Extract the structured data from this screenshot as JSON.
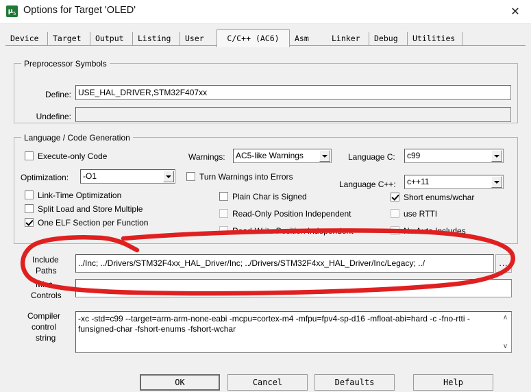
{
  "window": {
    "title": "Options for Target 'OLED'",
    "icon": "keil-uvision5-icon",
    "close_label": "✕"
  },
  "tabs": [
    {
      "label": "Device",
      "selected": false
    },
    {
      "label": "Target",
      "selected": false
    },
    {
      "label": "Output",
      "selected": false
    },
    {
      "label": "Listing",
      "selected": false
    },
    {
      "label": "User",
      "selected": false
    },
    {
      "label": "C/C++ (AC6)",
      "selected": true
    },
    {
      "label": "Asm",
      "selected": false
    },
    {
      "label": "Linker",
      "selected": false
    },
    {
      "label": "Debug",
      "selected": false
    },
    {
      "label": "Utilities",
      "selected": false
    }
  ],
  "preprocessor": {
    "legend": "Preprocessor Symbols",
    "define_label": "Define:",
    "define_value": "USE_HAL_DRIVER,STM32F407xx",
    "undefine_label": "Undefine:",
    "undefine_value": ""
  },
  "language": {
    "legend": "Language / Code Generation",
    "execute_only_code": "Execute-only Code",
    "optimization_label": "Optimization:",
    "optimization_value": "-O1",
    "link_time_optimization": "Link-Time Optimization",
    "split_load_store": "Split Load and Store Multiple",
    "one_elf_section": "One ELF Section per Function",
    "warnings_label": "Warnings:",
    "warnings_value": "AC5-like Warnings",
    "turn_warnings_into_errors": "Turn Warnings into Errors",
    "plain_char_is_signed": "Plain Char is Signed",
    "read_only_position_independent": "Read-Only Position Independent",
    "read_write_position_independent": "Read-Write Position Independent",
    "language_c_label": "Language C:",
    "language_c_value": "c99",
    "language_cpp_label": "Language C++:",
    "language_cpp_value": "c++11",
    "short_enums_wchar": "Short enums/wchar",
    "use_rtti": "use RTTI",
    "no_auto_includes": "No Auto Includes"
  },
  "paths": {
    "include_label_line1": "Include",
    "include_label_line2": "Paths",
    "include_value": "../Inc;  ../Drivers/STM32F4xx_HAL_Driver/Inc;  ../Drivers/STM32F4xx_HAL_Driver/Inc/Legacy;  ../",
    "include_browse_label": "...",
    "misc_label_line1": "Misc",
    "misc_label_line2": "Controls",
    "misc_value": ""
  },
  "compiler": {
    "label_line1": "Compiler",
    "label_line2": "control",
    "label_line3": "string",
    "value": "-xc -std=c99 --target=arm-arm-none-eabi -mcpu=cortex-m4 -mfpu=fpv4-sp-d16 -mfloat-abi=hard -c -fno-rtti -funsigned-char -fshort-enums -fshort-wchar",
    "scroll_up": "∧",
    "scroll_down": "∨"
  },
  "buttons": {
    "ok": "OK",
    "cancel": "Cancel",
    "defaults": "Defaults",
    "help": "Help"
  },
  "annotation": {
    "color": "#e02020",
    "shape": "hand-drawn-ellipse-around-include-paths"
  }
}
